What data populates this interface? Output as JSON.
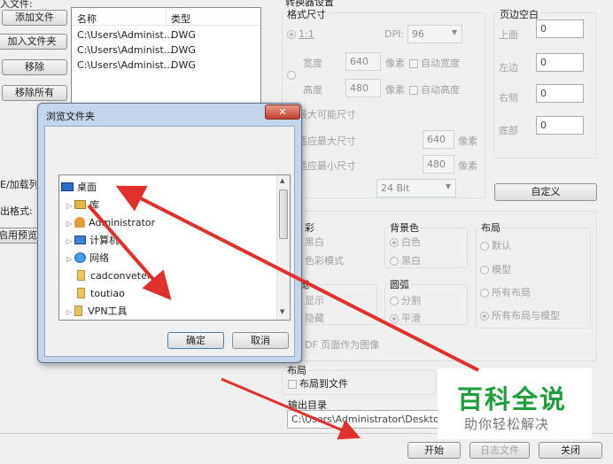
{
  "left_buttons": {
    "add_file": "添加文件",
    "add_folder": "加入文件夹",
    "remove": "移除",
    "remove_all": "移除所有"
  },
  "top_left_label": "入文件:",
  "file_table": {
    "headers": [
      "名称",
      "类型"
    ],
    "rows": [
      [
        "C:\\Users\\Administ...",
        "DWG"
      ],
      [
        "C:\\Users\\Administ...",
        "DWG"
      ],
      [
        "C:\\Users\\Administ...",
        "DWG"
      ]
    ]
  },
  "side_labels": {
    "a": "E/加载列表",
    "b": "出格式:",
    "c": "启用预览"
  },
  "converter": {
    "title": "转换器设置",
    "format_size": "格式尺寸",
    "ratio": "1:1",
    "dpi_label": "DPI:",
    "dpi_value": "96",
    "width_label": "宽度",
    "width_value": "640",
    "width_unit": "像素",
    "auto_width": "自动宽度",
    "height_label": "高度",
    "height_value": "480",
    "height_unit": "像素",
    "auto_height": "自动高度",
    "max_size": "最大可能尺寸",
    "fit_max": "适应最大尺寸",
    "fit_max_value": "640",
    "fit_max_unit": "像素",
    "fit_min": "适应最小尺寸",
    "fit_min_value": "480",
    "fit_min_unit": "像素",
    "bit_depth": "24 Bit",
    "margin_title": "页边空白",
    "top": "上面",
    "top_v": "0",
    "left": "左边",
    "left_v": "0",
    "right": "右侧",
    "right_v": "0",
    "bottom": "底部",
    "bottom_v": "0",
    "custom": "自定义",
    "color_title": "彩",
    "bw": "黑白",
    "color_mode": "色彩模式",
    "bg_title": "背景色",
    "white": "白色",
    "black": "黑白",
    "layout_title": "布局",
    "default": "默认",
    "model": "模型",
    "all_layouts": "所有布局",
    "all_layouts_model": "所有布局与模型",
    "line_title": "宽",
    "show": "显示",
    "hide": "隐藏",
    "arc_title": "圆弧",
    "split": "分割",
    "smooth": "平滑",
    "pdf_page": "DF 页面作为图像",
    "layout2_title": "布局",
    "layout_to_file": "布局到文件",
    "output_title": "输出目录",
    "output_path": "C:\\Users\\Administrator\\Desktop\\"
  },
  "bottom": {
    "start": "开始",
    "log": "日志文件",
    "close": "关闭"
  },
  "dialog": {
    "title": "浏览文件夹",
    "tree": [
      {
        "label": "桌面",
        "indent": 0,
        "icon": "desktop"
      },
      {
        "label": "库",
        "indent": 1,
        "icon": "library"
      },
      {
        "label": "Administrator",
        "indent": 1,
        "icon": "user"
      },
      {
        "label": "计算机",
        "indent": 1,
        "icon": "computer"
      },
      {
        "label": "网络",
        "indent": 1,
        "icon": "network"
      },
      {
        "label": "cadconveter",
        "indent": 1,
        "icon": "folder"
      },
      {
        "label": "toutiao",
        "indent": 1,
        "icon": "folder"
      },
      {
        "label": "VPN工具",
        "indent": 1,
        "icon": "folder"
      }
    ],
    "ok": "确定",
    "cancel": "取消"
  },
  "watermark": {
    "title": "百科全说",
    "subtitle": "助你轻松解决"
  },
  "colors": {
    "arrow": "#e0302b",
    "watermark_green": "#1e9e3c"
  }
}
